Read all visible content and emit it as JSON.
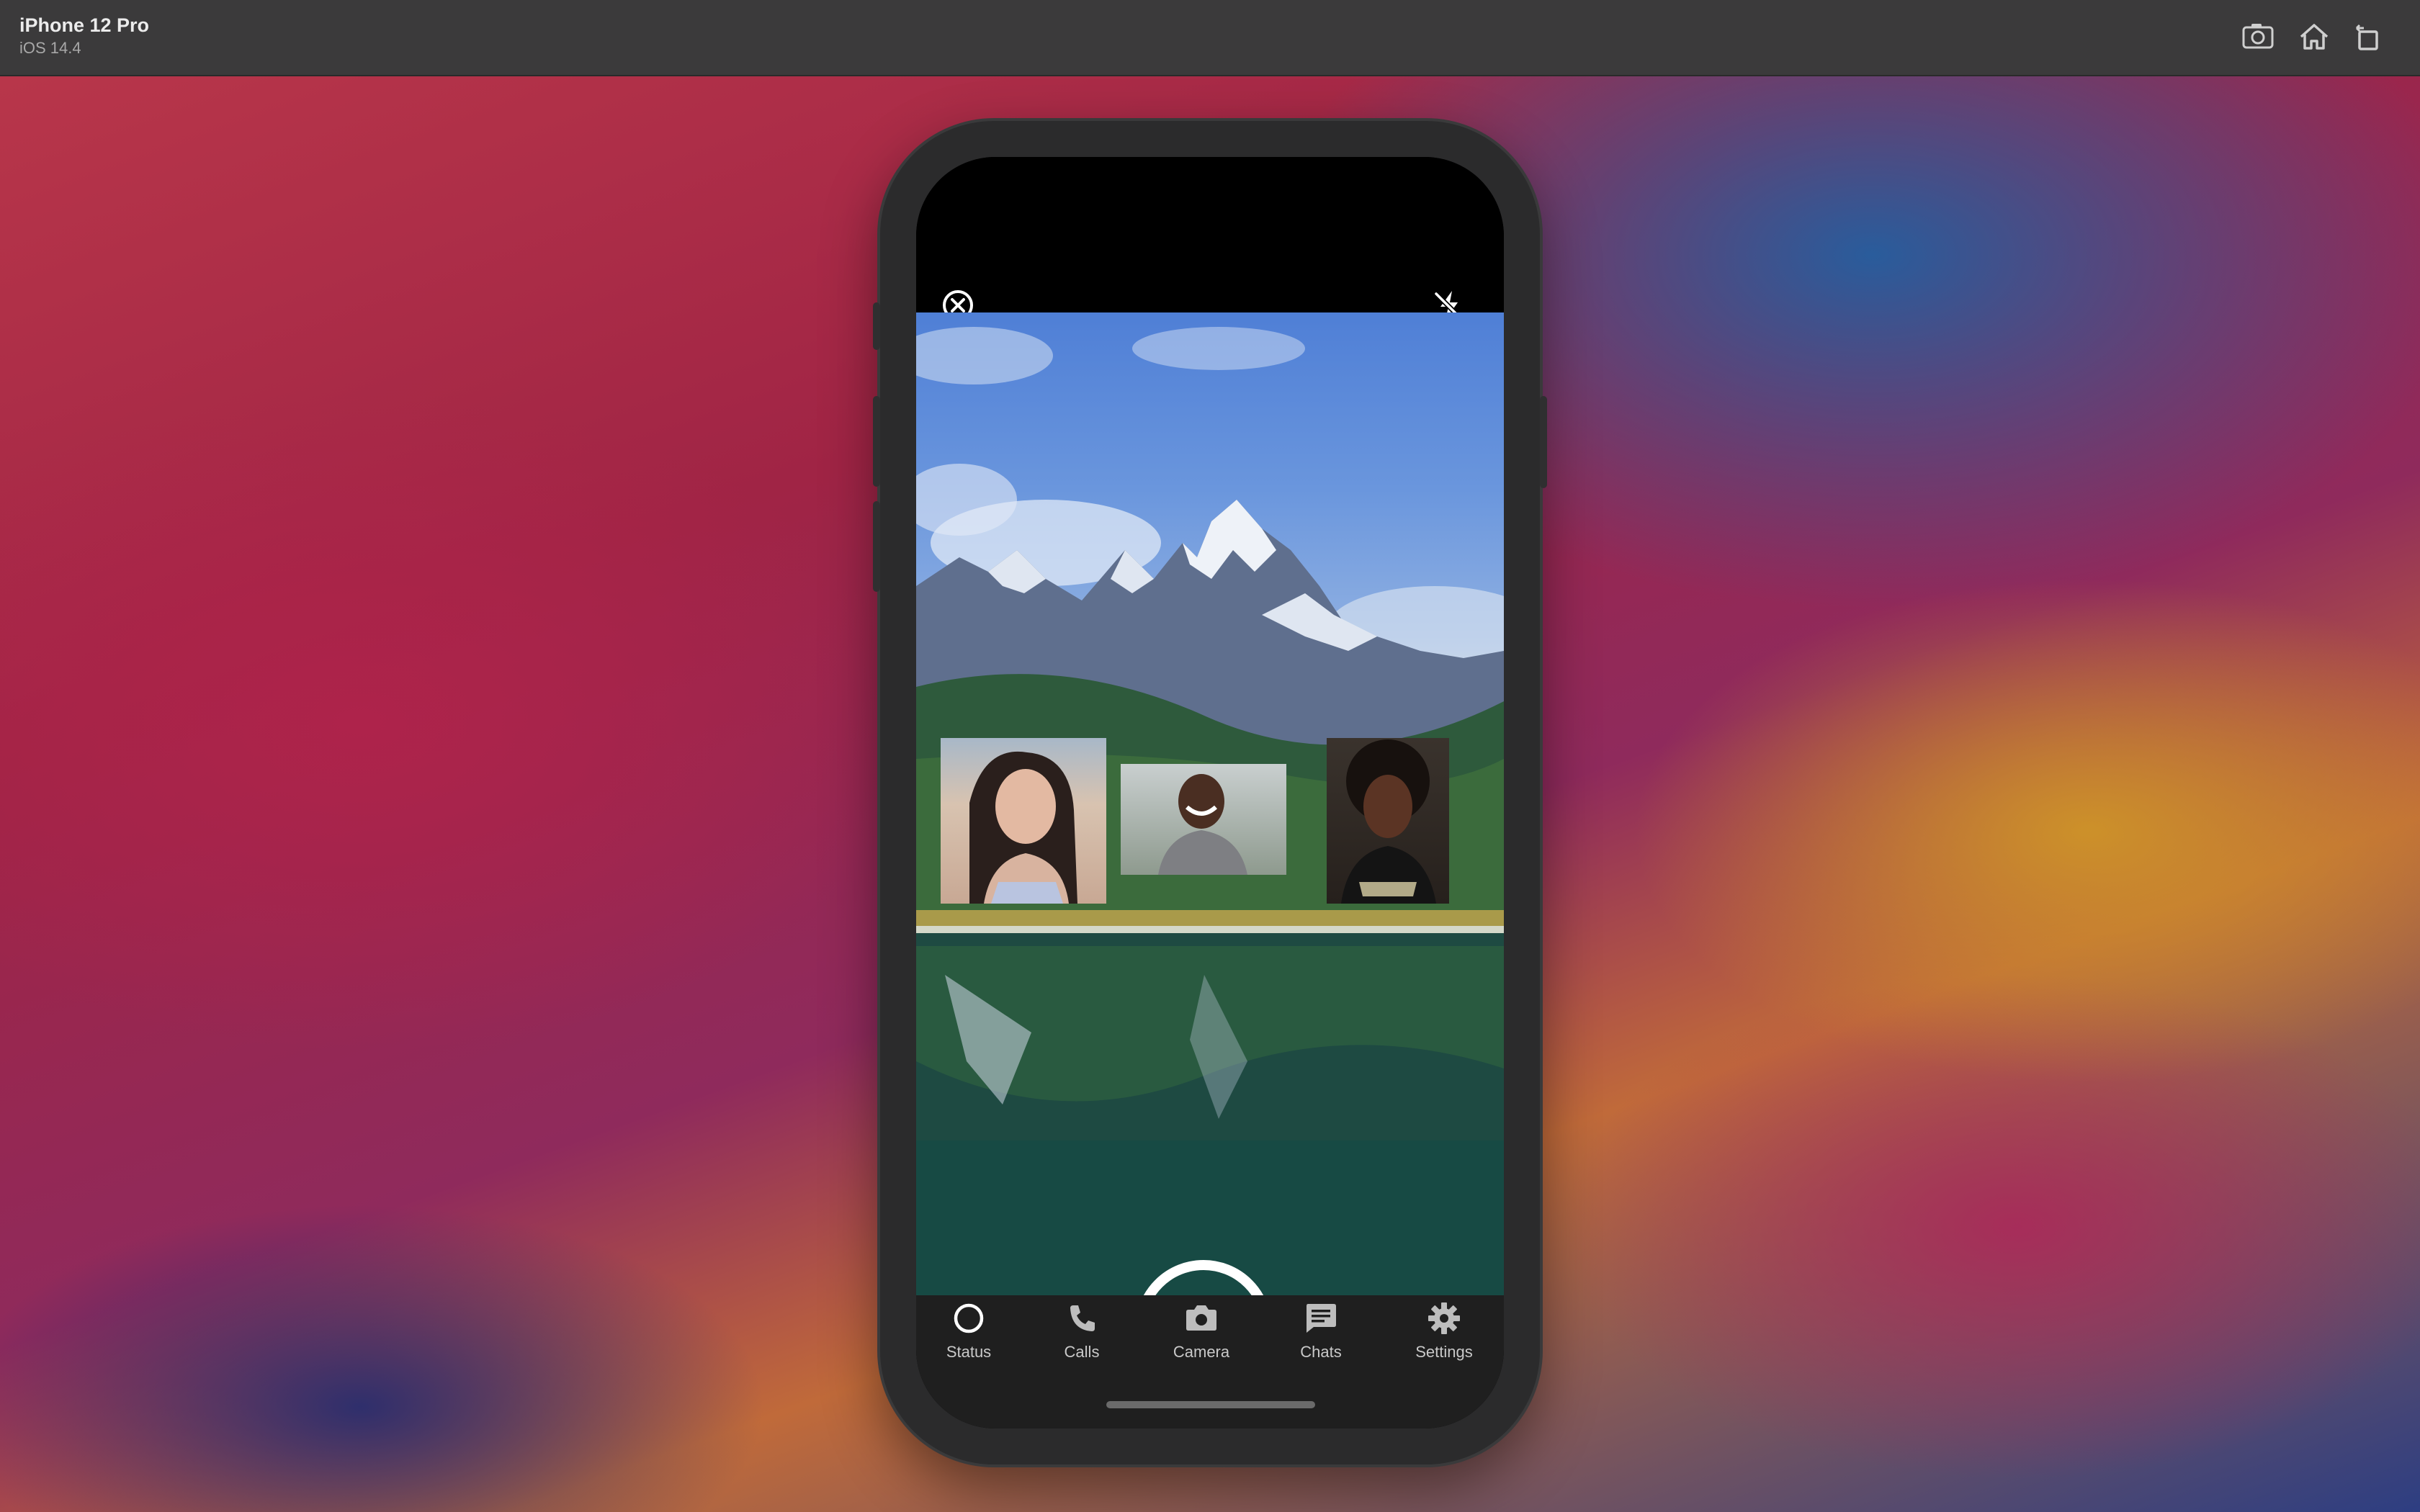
{
  "simulator": {
    "device_name": "iPhone 12 Pro",
    "os_version": "iOS 14.4",
    "toolbar": [
      {
        "name": "screenshot-icon"
      },
      {
        "name": "home-icon"
      },
      {
        "name": "rotate-icon"
      }
    ]
  },
  "camera": {
    "top_left_icon": "close-circle-icon",
    "top_right_icon": "flash-off-icon",
    "gallery_icon": "image-icon",
    "switch_camera_icon": "camera-icon",
    "shutter_icon": "shutter-ring"
  },
  "tabs": [
    {
      "label": "Status",
      "icon": "circle-icon"
    },
    {
      "label": "Calls",
      "icon": "phone-icon"
    },
    {
      "label": "Camera",
      "icon": "camera-icon"
    },
    {
      "label": "Chats",
      "icon": "chat-icon"
    },
    {
      "label": "Settings",
      "icon": "gear-icon"
    }
  ],
  "colors": {
    "titlebar": "#3b3a3b",
    "phone_frame": "#2b2b2c",
    "tabbar": "#1f1f1f",
    "tab_label": "#c9c9c9"
  }
}
